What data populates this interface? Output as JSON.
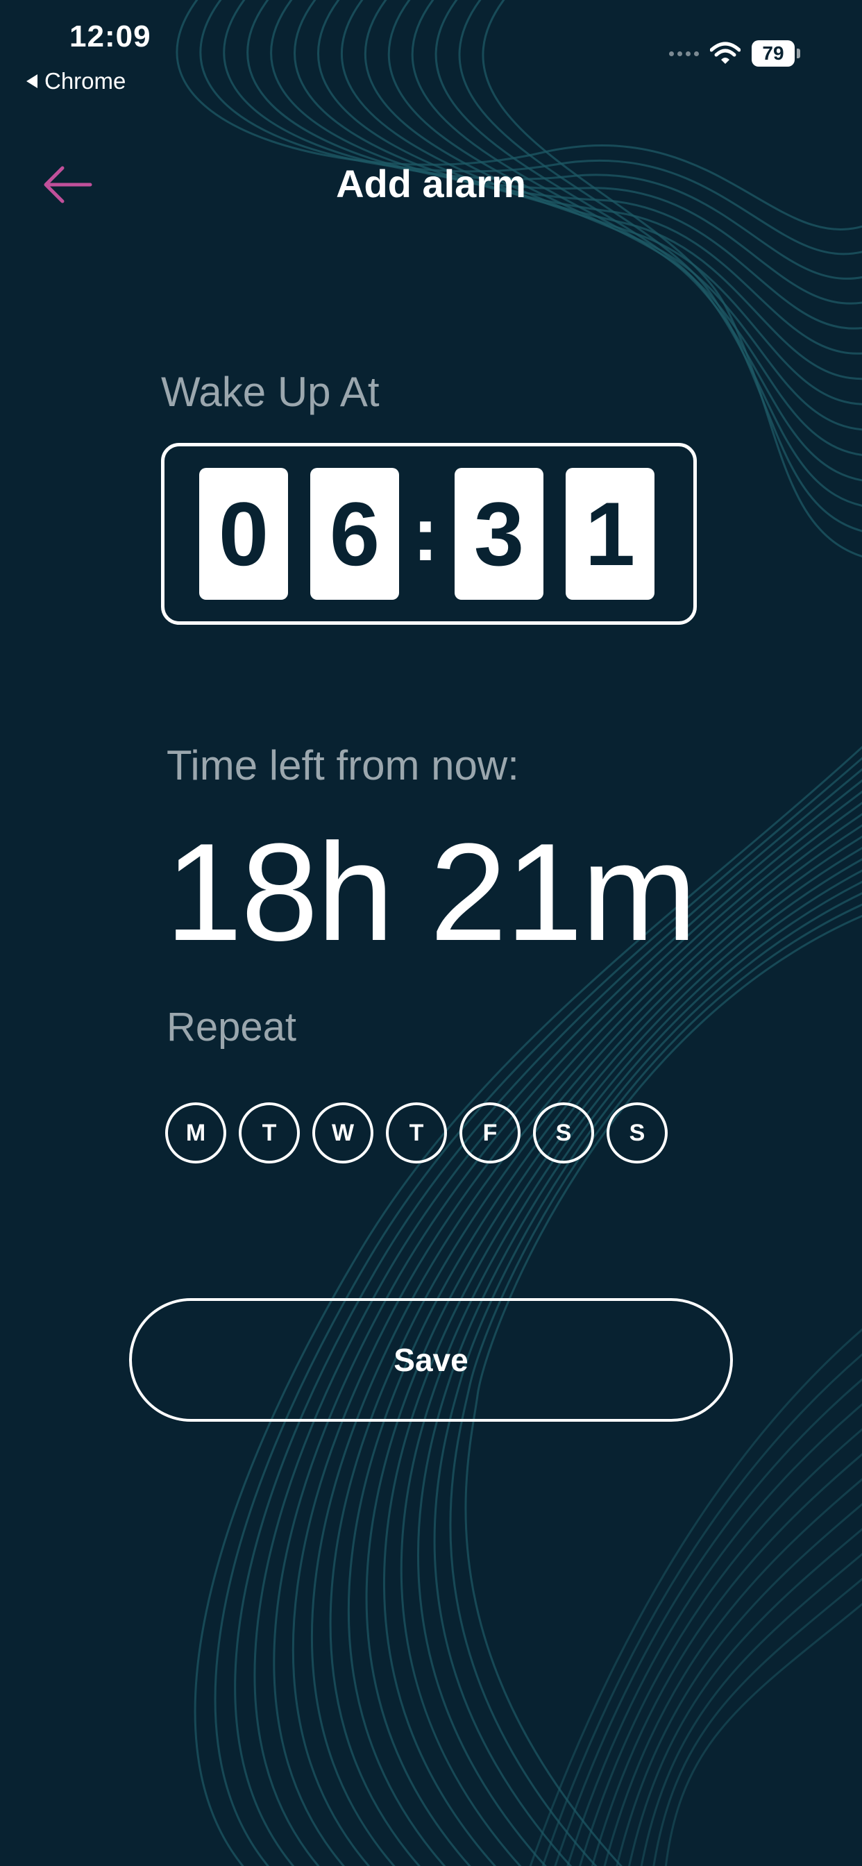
{
  "status_bar": {
    "time": "12:09",
    "back_app": "Chrome",
    "battery": "79"
  },
  "header": {
    "title": "Add alarm"
  },
  "wake": {
    "label": "Wake Up At",
    "digits": [
      "0",
      "6",
      "3",
      "1"
    ],
    "separator": ":"
  },
  "time_left": {
    "label": "Time left from now:",
    "value": "18h 21m"
  },
  "repeat": {
    "label": "Repeat",
    "days": [
      "M",
      "T",
      "W",
      "T",
      "F",
      "S",
      "S"
    ]
  },
  "save_label": "Save",
  "colors": {
    "background": "#082231",
    "accent": "#c0509a",
    "wave": "#1e5a66"
  }
}
